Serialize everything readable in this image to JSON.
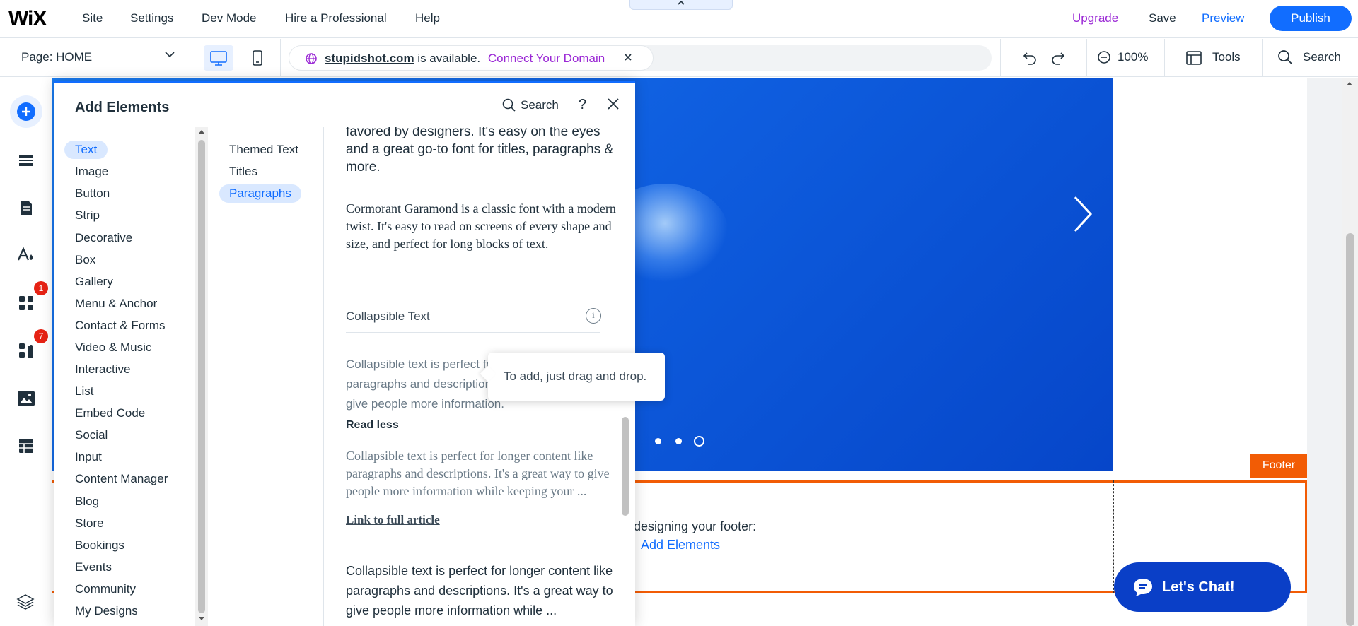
{
  "topbar": {
    "logo": "WiX",
    "menu": [
      "Site",
      "Settings",
      "Dev Mode",
      "Hire a Professional",
      "Help"
    ],
    "notch_icon": "chevron-up-icon",
    "upgrade": "Upgrade",
    "save": "Save",
    "preview": "Preview",
    "publish": "Publish",
    "colors": {
      "publish": "#116dff",
      "upgrade": "#9a27d5"
    }
  },
  "subbar": {
    "page": "Page: HOME",
    "domain_name": "stupidshot.com",
    "domain_status": "is available.",
    "connect": "Connect Your Domain",
    "zoom": "100%",
    "tools": "Tools",
    "search": "Search"
  },
  "rail": {
    "badges": [
      "1",
      "7"
    ]
  },
  "panel": {
    "title": "Add Elements",
    "search": "Search",
    "help": "?",
    "categories": [
      "Text",
      "Image",
      "Button",
      "Strip",
      "Decorative",
      "Box",
      "Gallery",
      "Menu & Anchor",
      "Contact & Forms",
      "Video & Music",
      "Interactive",
      "List",
      "Embed Code",
      "Social",
      "Input",
      "Content Manager",
      "Blog",
      "Store",
      "Bookings",
      "Events",
      "Community",
      "My Designs"
    ],
    "subcategories": [
      "Themed Text",
      "Titles",
      "Paragraphs"
    ],
    "content": {
      "text1": "favored by designers. It's easy on the eyes and a great go-to font for titles, paragraphs & more.",
      "text2": "Cormorant Garamond is a classic font with a modern twist. It's easy to read on screens of every shape and size, and perfect for long blocks of text.",
      "collapsible_label": "Collapsible Text",
      "info": "i",
      "text3": "Collapsible text is perfect for longer content like paragraphs and descriptions. It's a great way to give people more information.",
      "read_less": "Read less",
      "text4": "Collapsible text is perfect for longer content like paragraphs and descriptions. It's a great way to give people more information while keeping your ...",
      "link": "Link to full article",
      "text5": "Collapsible text is perfect for longer content like paragraphs and descriptions. It's a great way to give people more information while ..."
    },
    "tooltip": "To add, just drag and drop."
  },
  "canvas": {
    "footer_tag": "Footer",
    "footer_hint": "designing your footer:",
    "footer_add": "Add Elements",
    "chat": "Let's Chat!"
  }
}
